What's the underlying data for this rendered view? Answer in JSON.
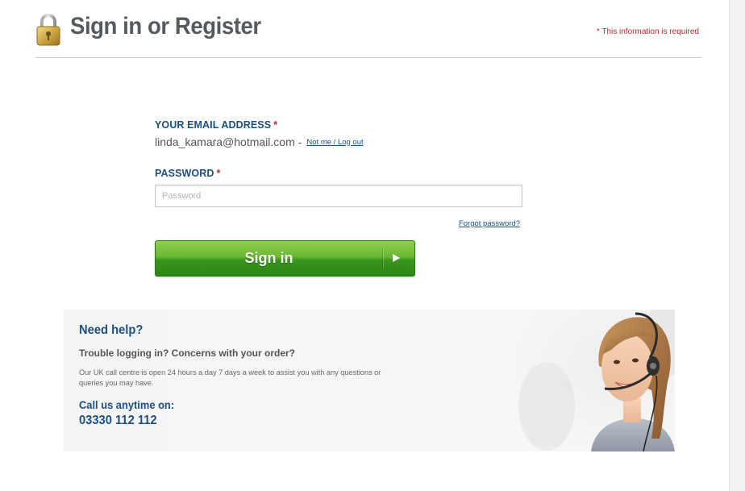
{
  "header": {
    "title": "Sign in or Register",
    "required_note": "* This information is required",
    "icon": "padlock-icon"
  },
  "form": {
    "email": {
      "label": "YOUR EMAIL ADDRESS",
      "required_marker": "*",
      "value": "linda_kamara@hotmail.com",
      "separator": "-",
      "logout_link": "Not me / Log out"
    },
    "password": {
      "label": "PASSWORD",
      "required_marker": "*",
      "placeholder": "Password",
      "value": ""
    },
    "forgot_link": "Forgot password?",
    "signin_button": {
      "label": "Sign in",
      "icon": "play-icon"
    }
  },
  "help": {
    "title": "Need help?",
    "subtitle": "Trouble logging in? Concerns with your order?",
    "body": "Our UK call centre is open 24 hours a day 7 days a week to assist you with any questions or queries you may have.",
    "call_label": "Call us anytime on:",
    "phone": "03330 112 112"
  },
  "colors": {
    "brand_blue": "#1b4f82",
    "required_red": "#c0262d",
    "button_green": "#3a951d",
    "title_gray": "#555a5f"
  }
}
